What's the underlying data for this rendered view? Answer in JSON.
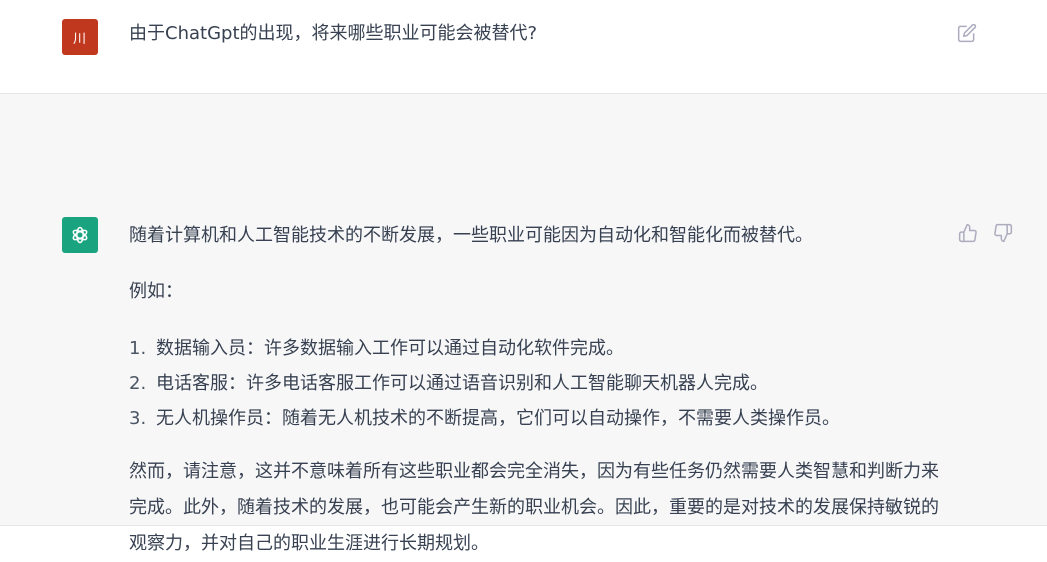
{
  "user_message": {
    "avatar_initials": "川",
    "avatar_color": "#c0391f",
    "text": "由于ChatGpt的出现，将来哪些职业可能会被替代?",
    "edit_icon": "edit-icon"
  },
  "assistant_message": {
    "avatar_icon": "openai-logo-icon",
    "avatar_color": "#19a37f",
    "intro": "随着计算机和人工智能技术的不断发展，一些职业可能因为自动化和智能化而被替代。",
    "example_label": "例如：",
    "list": [
      {
        "num": "1.",
        "text": "数据输入员：许多数据输入工作可以通过自动化软件完成。"
      },
      {
        "num": "2.",
        "text": "电话客服：许多电话客服工作可以通过语音识别和人工智能聊天机器人完成。"
      },
      {
        "num": "3.",
        "text": "无人机操作员：随着无人机技术的不断提高，它们可以自动操作，不需要人类操作员。"
      }
    ],
    "conclusion": "然而，请注意，这并不意味着所有这些职业都会完全消失，因为有些任务仍然需要人类智慧和判断力来完成。此外，随着技术的发展，也可能会产生新的职业机会。因此，重要的是对技术的发展保持敏锐的观察力，并对自己的职业生涯进行长期规划。",
    "thumbs_up_icon": "thumbs-up-icon",
    "thumbs_down_icon": "thumbs-down-icon"
  }
}
